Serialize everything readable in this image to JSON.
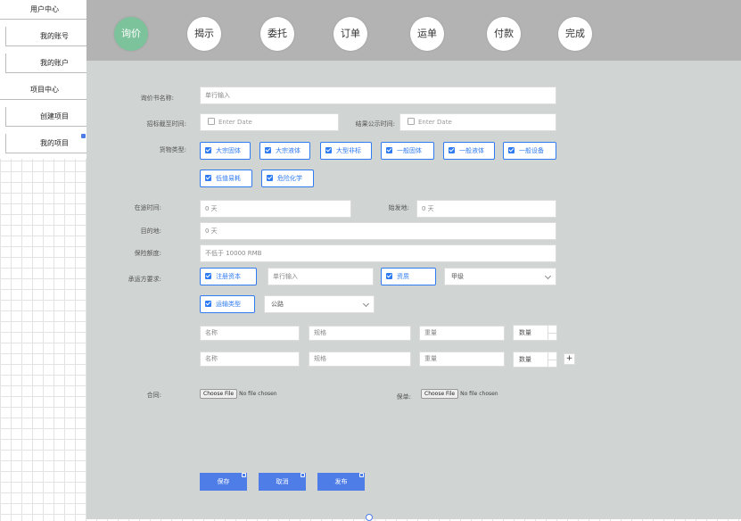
{
  "sidebar": {
    "user_center": "用户中心",
    "my_account_no": "我的账号",
    "my_account": "我的账户",
    "project_center": "项目中心",
    "create_project": "创建项目",
    "my_projects": "我的项目"
  },
  "steps": [
    "询价",
    "揭示",
    "委托",
    "订单",
    "运单",
    "付款",
    "完成"
  ],
  "active_step": "询价",
  "form": {
    "inquiry_name_label": "询价书名称:",
    "inquiry_name_placeholder": "单行输入",
    "bid_deadline_label": "招标截至时间:",
    "bid_deadline_placeholder": "Enter Date",
    "result_time_label": "结果公示时间:",
    "result_time_placeholder": "Enter Date",
    "cargo_type_label": "货物类型:",
    "cargo_types": [
      "大宗固体",
      "大宗液体",
      "大型非标",
      "一般固体",
      "一般液体",
      "一般设备",
      "低值易耗",
      "危险化学"
    ],
    "transit_time_label": "在途时间:",
    "transit_time_value": "0 天",
    "origin_label": "始发地:",
    "origin_value": "0 天",
    "destination_label": "目的地:",
    "destination_value": "0 天",
    "insurance_label": "保险额度:",
    "insurance_value": "不低于 10000 RMB",
    "carrier_req_label": "承运方要求:",
    "registered_capital": "注册资本",
    "registered_capital_placeholder": "单行输入",
    "qualification": "资质",
    "qualification_value": "甲级",
    "transport_type": "运输类型",
    "transport_type_value": "公路",
    "goods_rows": [
      {
        "name": "名称",
        "spec": "规格",
        "weight": "重量",
        "qty": "数量"
      },
      {
        "name": "名称",
        "spec": "规格",
        "weight": "重量",
        "qty": "数量"
      }
    ],
    "add_row": "+",
    "contract_label": "合同:",
    "policy_label": "保单:",
    "choose_file": "Choose File",
    "no_file": "No file chosen"
  },
  "actions": {
    "save": "保存",
    "cancel": "取消",
    "publish": "发布"
  },
  "colors": {
    "accent": "#4f7de8",
    "checkbox_blue": "#2f7bf2",
    "active_step": "#7cc39c",
    "topbar": "#b3b3b3",
    "panel": "#d0d4d2"
  }
}
